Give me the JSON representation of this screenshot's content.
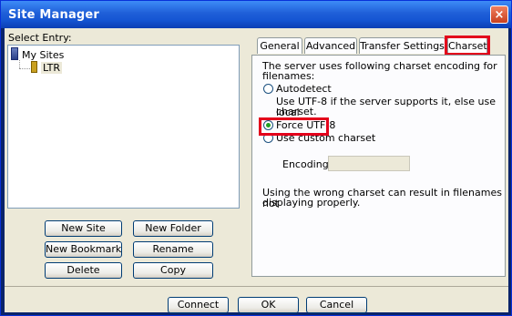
{
  "window": {
    "title": "Site Manager",
    "close_glyph": "×"
  },
  "left": {
    "select_label": "Select Entry:",
    "tree": [
      {
        "label": "My Sites",
        "icon": "folder-icon"
      },
      {
        "label": "LTR",
        "icon": "server-icon"
      }
    ],
    "buttons": {
      "new_site": "New Site",
      "new_folder": "New Folder",
      "new_bookmark": "New Bookmark",
      "rename": "Rename",
      "delete": "Delete",
      "copy": "Copy"
    }
  },
  "tabs": [
    "General",
    "Advanced",
    "Transfer Settings",
    "Charset"
  ],
  "active_tab": "Charset",
  "charset": {
    "intro_line1": "The server uses following charset encoding for",
    "intro_line2": "filenames:",
    "autodetect": "Autodetect",
    "autodetect_desc1": "Use UTF-8 if the server supports it, else use local",
    "autodetect_desc2": "charset.",
    "force_utf8": "Force UTF-8",
    "use_custom": "Use custom charset",
    "encoding_label": "Encoding:",
    "encoding_value": "",
    "warning1": "Using the wrong charset can result in filenames not",
    "warning2": "displaying properly.",
    "selected_option": "Force UTF-8"
  },
  "footer": {
    "connect": "Connect",
    "ok": "OK",
    "cancel": "Cancel"
  },
  "colors": {
    "highlight": "#e3001b",
    "titlebar": "#1f5fd8"
  }
}
